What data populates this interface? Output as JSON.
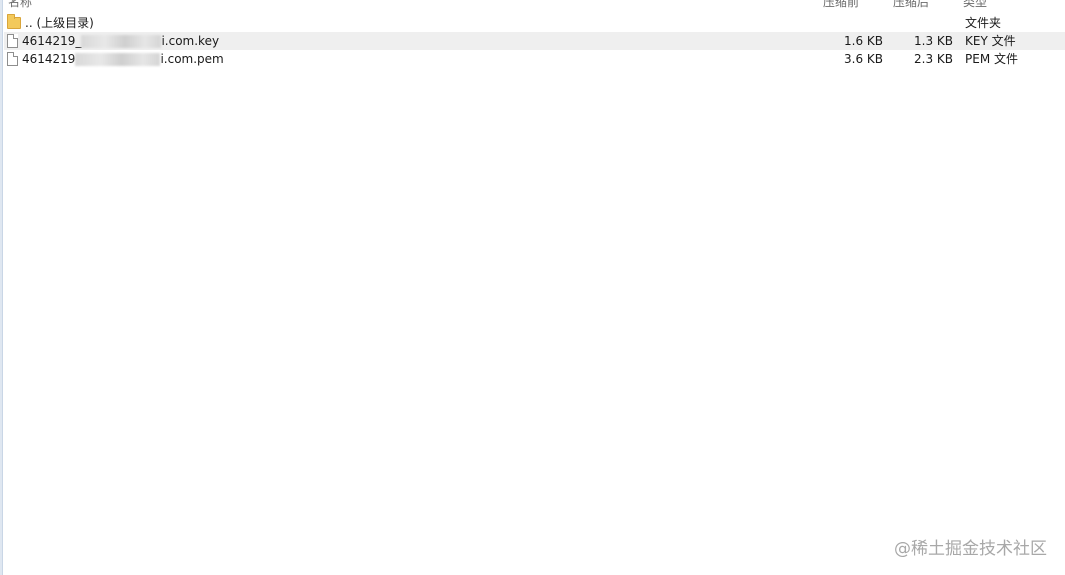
{
  "header": {
    "name": "名称",
    "original_size": "压缩前",
    "compressed_size": "压缩后",
    "type": "类型"
  },
  "rows": [
    {
      "icon": "folder-icon",
      "name": ".. (上级目录)",
      "original_size": "",
      "compressed_size": "",
      "type": "文件夹"
    },
    {
      "icon": "file-icon",
      "name_prefix": "4614219_",
      "name_suffix": "i.com.key",
      "original_size": "1.6 KB",
      "compressed_size": "1.3 KB",
      "type": "KEY 文件"
    },
    {
      "icon": "file-icon",
      "name_prefix": "4614219",
      "name_suffix": "i.com.pem",
      "original_size": "3.6 KB",
      "compressed_size": "2.3 KB",
      "type": "PEM 文件"
    }
  ],
  "watermark": "@稀土掘金技术社区"
}
